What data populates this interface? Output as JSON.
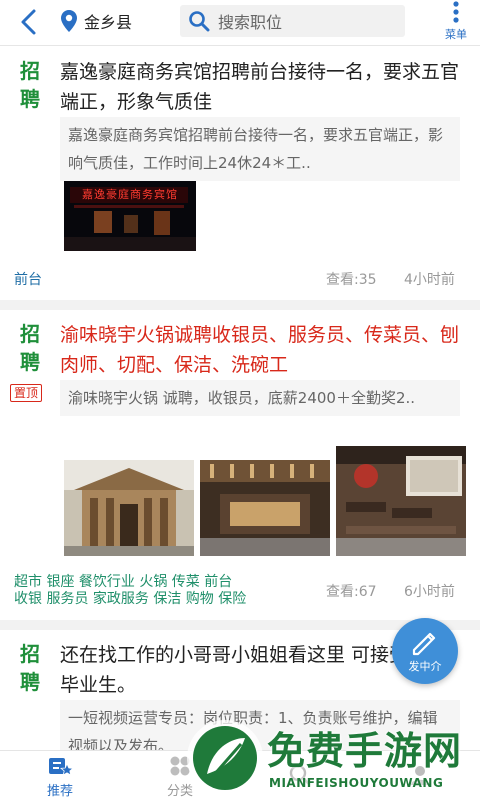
{
  "header": {
    "location": "金乡县",
    "search_placeholder": "搜索职位",
    "menu_label": "菜单"
  },
  "listings": [
    {
      "badge": "招聘",
      "title": "嘉逸豪庭商务宾馆招聘前台接待一名，要求五官端正，形象气质佳",
      "snippet": "嘉逸豪庭商务宾馆招聘前台接待一名，要求五官端正，影响气质佳，工作时间上24休24＊工..",
      "photo_sign": "嘉逸豪庭商务宾馆",
      "category": "前台",
      "views": "查看:35",
      "time": "4小时前"
    },
    {
      "badge": "招聘",
      "pinned_label": "置顶",
      "title": "渝味晓宇火锅诚聘收银员、服务员、传菜员、刨肉师、切配、保洁、洗碗工",
      "snippet": "渝味晓宇火锅 诚聘，收银员，底薪2400＋全勤奖2..",
      "tags_line1": "超市 银座 餐饮行业 火锅 传菜 前台",
      "tags_line2": "收银 服务员 家政服务 保洁 购物 保险",
      "views": "查看:67",
      "time": "6小时前"
    },
    {
      "badge": "招聘",
      "title": "还在找工作的小哥哥小姐姐看这里 可接受应届毕业生。",
      "snippet": "一短视频运营专员：岗位职责：1、负责账号维护，编辑视频以及发布。"
    }
  ],
  "fab": {
    "label": "发中介"
  },
  "bottom_nav": [
    {
      "label": "推荐",
      "active": true
    },
    {
      "label": "分类",
      "active": false
    },
    {
      "label": "",
      "active": false
    },
    {
      "label": "",
      "active": false
    }
  ],
  "watermark": {
    "title": "免费手游网",
    "subtitle": "MIANFEISHOUYOUWANG"
  },
  "colors": {
    "accent_blue": "#2a6fc4",
    "badge_green": "#1f8f3a",
    "highlight_red": "#d8281a"
  }
}
